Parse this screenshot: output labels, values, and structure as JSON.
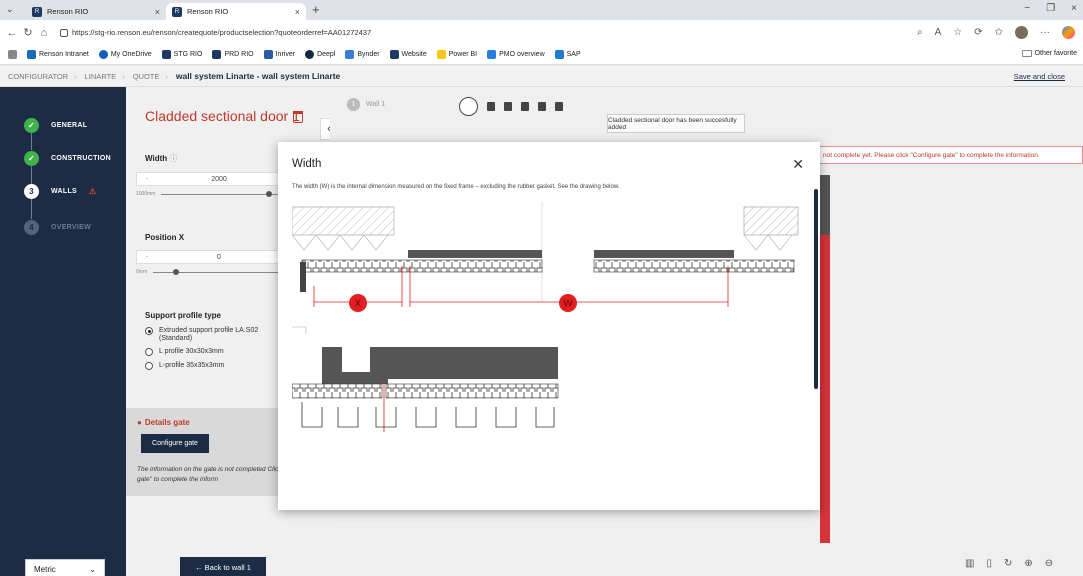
{
  "browser": {
    "tabs": [
      {
        "title": "Renson RIO"
      },
      {
        "title": "Renson RIO"
      }
    ],
    "url": "https://stg-rio.renson.eu/renson/createquote/productselection?quoteorderref=AA01272437",
    "bookmarks": [
      "Renson Intranet",
      "My OneDrive",
      "STG RIO",
      "PRD RIO",
      "Inriver",
      "Deepl",
      "Bynder",
      "Website",
      "Power BI",
      "PMO overview",
      "SAP"
    ],
    "other_favorites": "Other favorite"
  },
  "header": {
    "breadcrumbs": [
      "CONFIGURATOR",
      "LINARTE",
      "QUOTE"
    ],
    "current": "wall system Linarte - wall system Linarte",
    "save_close": "Save and close"
  },
  "sidebar": {
    "steps": [
      {
        "label": "GENERAL",
        "state": "done"
      },
      {
        "label": "CONSTRUCTION",
        "state": "done"
      },
      {
        "number": "3",
        "label": "WALLS",
        "state": "current",
        "warning": "⚠"
      },
      {
        "number": "4",
        "label": "OVERVIEW",
        "state": "todo"
      }
    ],
    "unit_select": "Metric"
  },
  "panel": {
    "title": "Cladded sectional door 1",
    "width_label": "Width",
    "width_value": "2000",
    "width_min": "1000mm",
    "position_label": "Position X",
    "position_value": "0",
    "position_min": "0mm",
    "support_label": "Support profile type",
    "support_options": [
      {
        "label": "Extruded support profile LA.S02 (Standard)",
        "selected": true
      },
      {
        "label": "L profile 30x30x3mm",
        "selected": false
      },
      {
        "label": "L-profile 35x35x3mm",
        "selected": false
      }
    ],
    "gate_heading": "Details gate",
    "gate_button": "Configure gate",
    "gate_note": "The information on the gate is not completed Click \"Configure gate\" to complete the inform",
    "back_button": "← Back to wall 1"
  },
  "canvas": {
    "wall_select": "Wall 1",
    "toast": "Cladded sectional door has been succesfully added",
    "banner": "not complete yet. Please click \"Configure gate\" to complete the information."
  },
  "modal": {
    "title": "Width",
    "description": "The width (W) is the internal dimension measured on the fixed frame – excluding the rubber gasket. See the drawing below.",
    "marker_x": "X",
    "marker_w": "W"
  },
  "colors": {
    "navy": "#1c2c44",
    "accent_red": "#c0392b",
    "success_green": "#3fb34a",
    "marker_red": "#e02020"
  }
}
